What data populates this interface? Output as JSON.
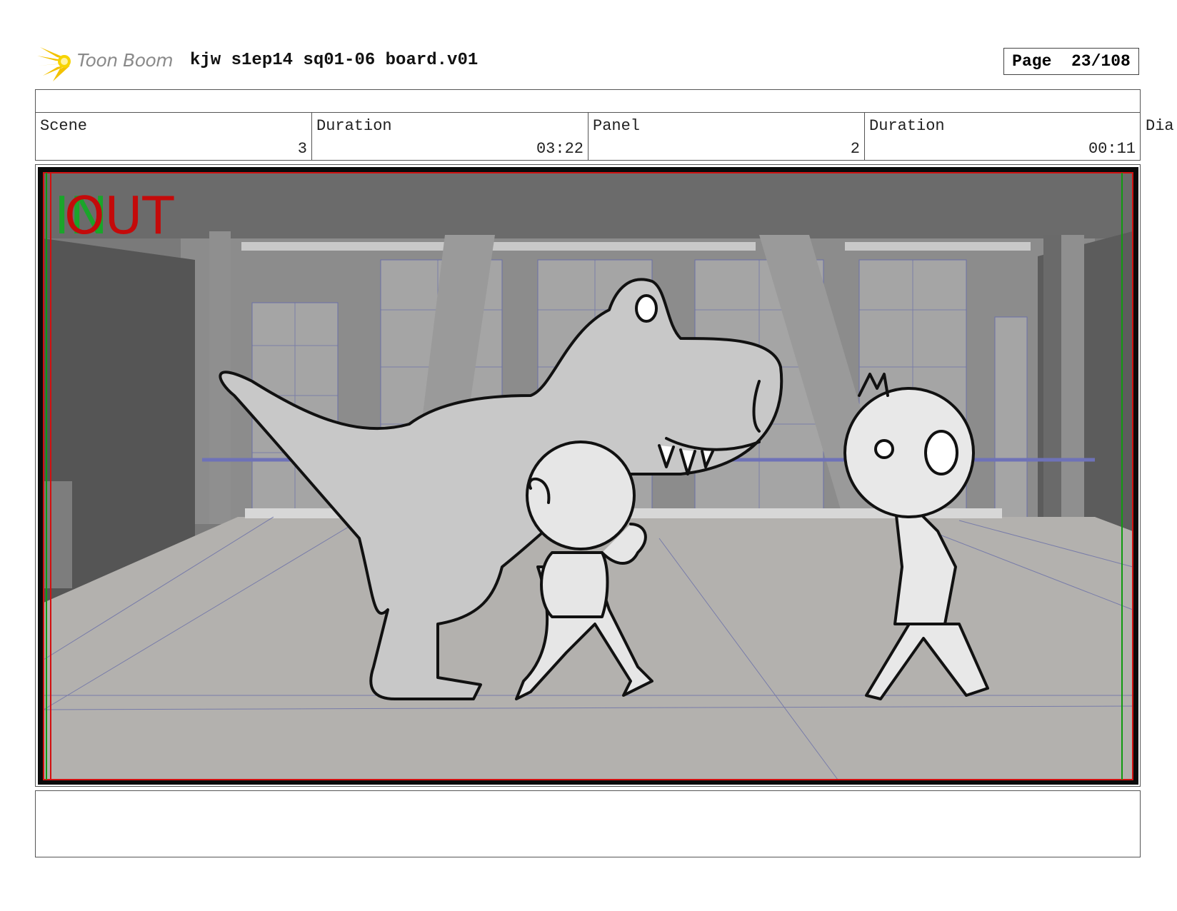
{
  "header": {
    "logo_text": "Toon Boom",
    "title": "kjw s1ep14 sq01-06 board.v01",
    "page_label": "Page",
    "page_value": "23/108"
  },
  "info": {
    "scene_label": "Scene",
    "scene_value": "3",
    "scene_duration_label": "Duration",
    "scene_duration_value": "03:22",
    "panel_label": "Panel",
    "panel_value": "2",
    "panel_duration_label": "Duration",
    "panel_duration_value": "00:11",
    "dialog_label": "Dia"
  },
  "panel": {
    "in_marker": "IN",
    "out_marker": "OUT",
    "colors": {
      "in": "#1aa52a",
      "out": "#c40a0a",
      "safe_red": "#d21010",
      "safe_green": "#109a10"
    }
  }
}
